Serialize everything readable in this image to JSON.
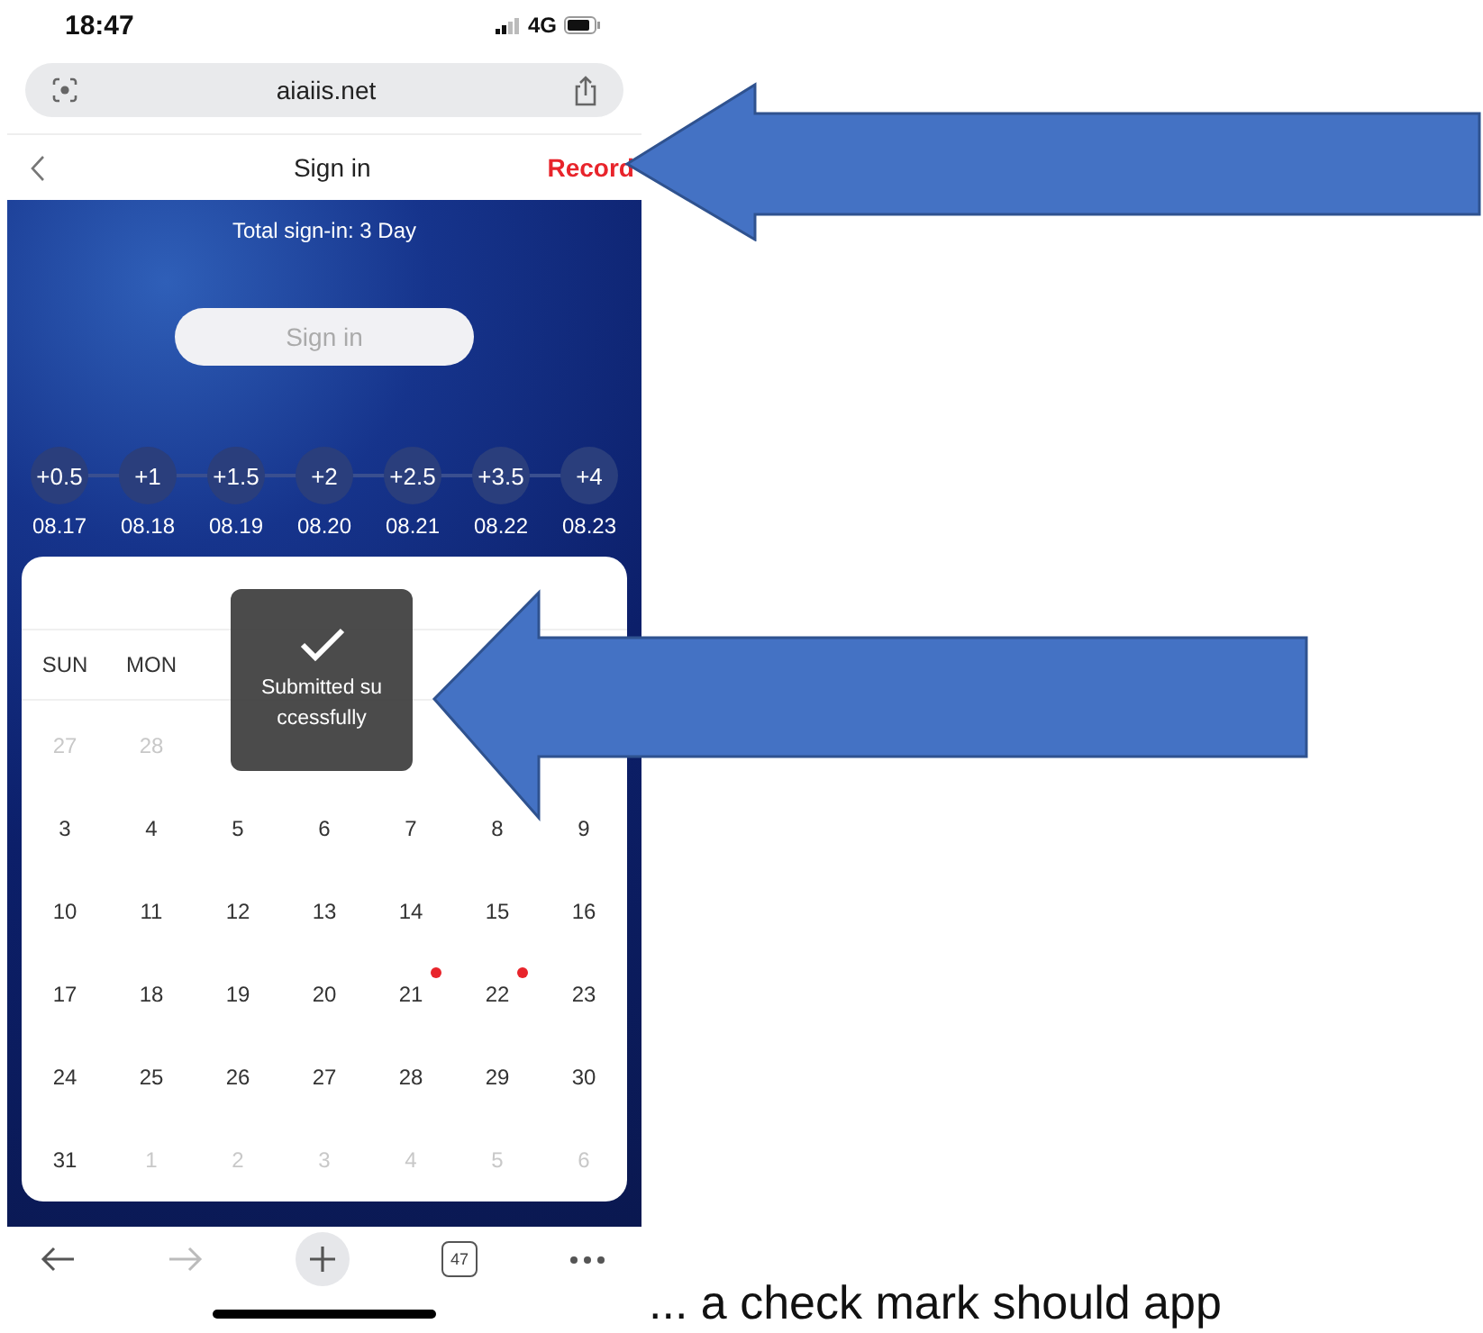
{
  "status_bar": {
    "time": "18:47",
    "network": "4G"
  },
  "browser": {
    "url": "aiaiis.net"
  },
  "nav": {
    "title": "Sign in",
    "action": "Record"
  },
  "summary": "Total sign-in: 3 Day",
  "sign_in_button": "Sign in",
  "rewards": [
    {
      "bonus": "+0.5",
      "date": "08.17"
    },
    {
      "bonus": "+1",
      "date": "08.18"
    },
    {
      "bonus": "+1.5",
      "date": "08.19"
    },
    {
      "bonus": "+2",
      "date": "08.20"
    },
    {
      "bonus": "+2.5",
      "date": "08.21"
    },
    {
      "bonus": "+3.5",
      "date": "08.22"
    },
    {
      "bonus": "+4",
      "date": "08.23"
    }
  ],
  "calendar": {
    "weekdays": [
      "SUN",
      "MON"
    ],
    "weeks": [
      [
        {
          "day": "27",
          "muted": true,
          "marked": false
        },
        {
          "day": "28",
          "muted": true,
          "marked": false
        }
      ],
      [
        {
          "day": "3",
          "muted": false,
          "marked": false
        },
        {
          "day": "4",
          "muted": false,
          "marked": false
        },
        {
          "day": "5",
          "muted": false,
          "marked": false
        },
        {
          "day": "6",
          "muted": false,
          "marked": false
        },
        {
          "day": "7",
          "muted": false,
          "marked": false
        },
        {
          "day": "8",
          "muted": false,
          "marked": false
        },
        {
          "day": "9",
          "muted": false,
          "marked": false
        }
      ],
      [
        {
          "day": "10",
          "muted": false,
          "marked": false
        },
        {
          "day": "11",
          "muted": false,
          "marked": false
        },
        {
          "day": "12",
          "muted": false,
          "marked": false
        },
        {
          "day": "13",
          "muted": false,
          "marked": false
        },
        {
          "day": "14",
          "muted": false,
          "marked": false
        },
        {
          "day": "15",
          "muted": false,
          "marked": false
        },
        {
          "day": "16",
          "muted": false,
          "marked": false
        }
      ],
      [
        {
          "day": "17",
          "muted": false,
          "marked": false
        },
        {
          "day": "18",
          "muted": false,
          "marked": false
        },
        {
          "day": "19",
          "muted": false,
          "marked": false
        },
        {
          "day": "20",
          "muted": false,
          "marked": false
        },
        {
          "day": "21",
          "muted": false,
          "marked": true
        },
        {
          "day": "22",
          "muted": false,
          "marked": true
        },
        {
          "day": "23",
          "muted": false,
          "marked": false
        }
      ],
      [
        {
          "day": "24",
          "muted": false,
          "marked": false
        },
        {
          "day": "25",
          "muted": false,
          "marked": false
        },
        {
          "day": "26",
          "muted": false,
          "marked": false
        },
        {
          "day": "27",
          "muted": false,
          "marked": false
        },
        {
          "day": "28",
          "muted": false,
          "marked": false
        },
        {
          "day": "29",
          "muted": false,
          "marked": false
        },
        {
          "day": "30",
          "muted": false,
          "marked": false
        }
      ],
      [
        {
          "day": "31",
          "muted": false,
          "marked": false
        },
        {
          "day": "1",
          "muted": true,
          "marked": false
        },
        {
          "day": "2",
          "muted": true,
          "marked": false
        },
        {
          "day": "3",
          "muted": true,
          "marked": false
        },
        {
          "day": "4",
          "muted": true,
          "marked": false
        },
        {
          "day": "5",
          "muted": true,
          "marked": false
        },
        {
          "day": "6",
          "muted": true,
          "marked": false
        }
      ]
    ]
  },
  "toast": {
    "lines": [
      "Submitted su",
      "ccessfully"
    ]
  },
  "toolbar": {
    "forward_disabled": true,
    "tab_count": "47"
  },
  "caption": "... a check mark should app"
}
